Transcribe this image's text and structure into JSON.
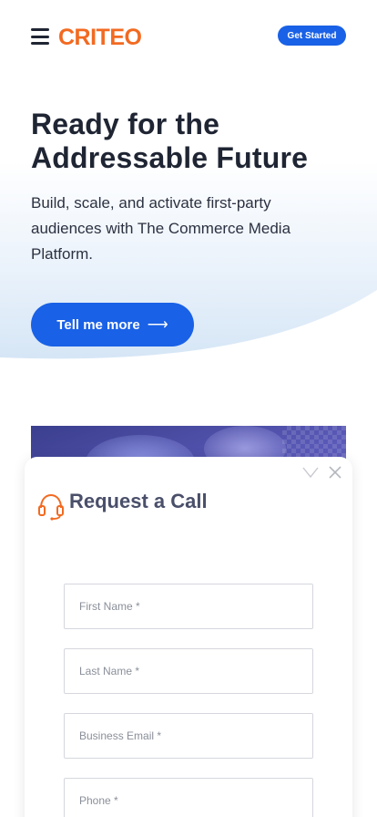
{
  "header": {
    "logo_text": "CRITEO",
    "get_started_label": "Get Started"
  },
  "hero": {
    "title": "Ready for the Addressable Future",
    "description": "Build, scale, and activate first-party audiences with The Commerce Media Platform.",
    "cta_label": "Tell me more",
    "cta_arrow": "⟶"
  },
  "modal": {
    "title": "Request a Call",
    "fields": {
      "first_name_placeholder": "First Name *",
      "last_name_placeholder": "Last Name *",
      "email_placeholder": "Business Email *",
      "phone_placeholder": "Phone *"
    }
  },
  "colors": {
    "brand_orange": "#f26a21",
    "primary_blue": "#1961e6",
    "text_dark": "#1f2533"
  }
}
